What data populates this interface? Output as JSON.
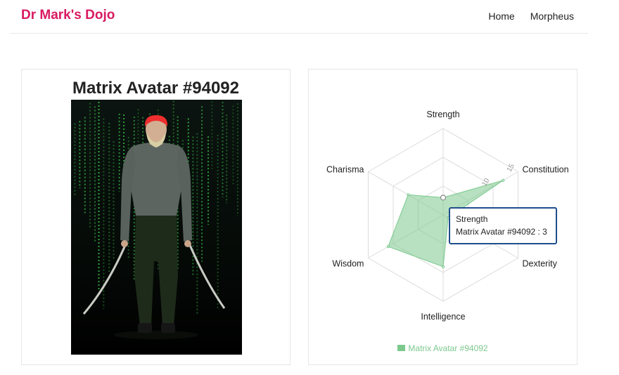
{
  "nav": {
    "brand": "Dr Mark's Dojo",
    "links": [
      "Home",
      "Morpheus"
    ]
  },
  "avatar": {
    "title": "Matrix Avatar #94092"
  },
  "tooltip": {
    "title": "Strength",
    "line": "Matrix Avatar #94092 : 3"
  },
  "colors": {
    "brand": "#d81b60",
    "series_fill": "#7cc98e",
    "tooltip_border": "#1f4e8c"
  },
  "chart_data": {
    "type": "radar",
    "axes": [
      "Strength",
      "Constitution",
      "Dexterity",
      "Intelligence",
      "Wisdom",
      "Charisma"
    ],
    "series": [
      {
        "name": "Matrix Avatar #94092",
        "values": [
          3,
          12,
          1,
          9,
          11,
          7
        ]
      }
    ],
    "rlim": [
      0,
      15
    ],
    "ticks": [
      5,
      10,
      15
    ],
    "tick_labels": [
      "",
      "10",
      "15"
    ],
    "legend": "bottom"
  }
}
